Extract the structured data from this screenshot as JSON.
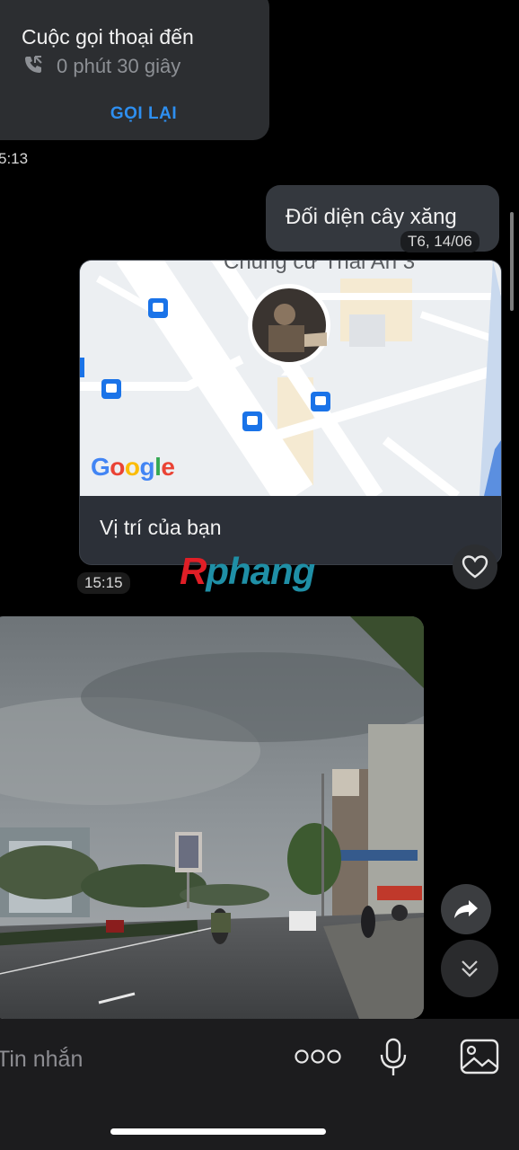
{
  "call": {
    "title": "Cuộc gọi thoại đến",
    "duration": "0 phút 30 giây",
    "callback_label": "GỌI LẠI",
    "time": "5:13"
  },
  "sent_message": {
    "text": "Đối diện cây xăng",
    "time": "T6, 14/06"
  },
  "location": {
    "map_label": "Chung cư Thái An 3",
    "map_brand": "Google",
    "caption": "Vị trí của bạn",
    "time": "15:15"
  },
  "watermark": {
    "part1": "R",
    "part2": "phang"
  },
  "input": {
    "placeholder": "Tin nhắn"
  },
  "icons": {
    "call": "incoming-call-icon",
    "heart": "heart-icon",
    "share": "share-arrow-icon",
    "scroll": "double-chevron-down-icon",
    "more": "more-dots-icon",
    "mic": "microphone-icon",
    "gallery": "image-gallery-icon"
  },
  "colors": {
    "accent": "#2e8ff0",
    "bubble": "#34383e",
    "background": "#000000"
  }
}
